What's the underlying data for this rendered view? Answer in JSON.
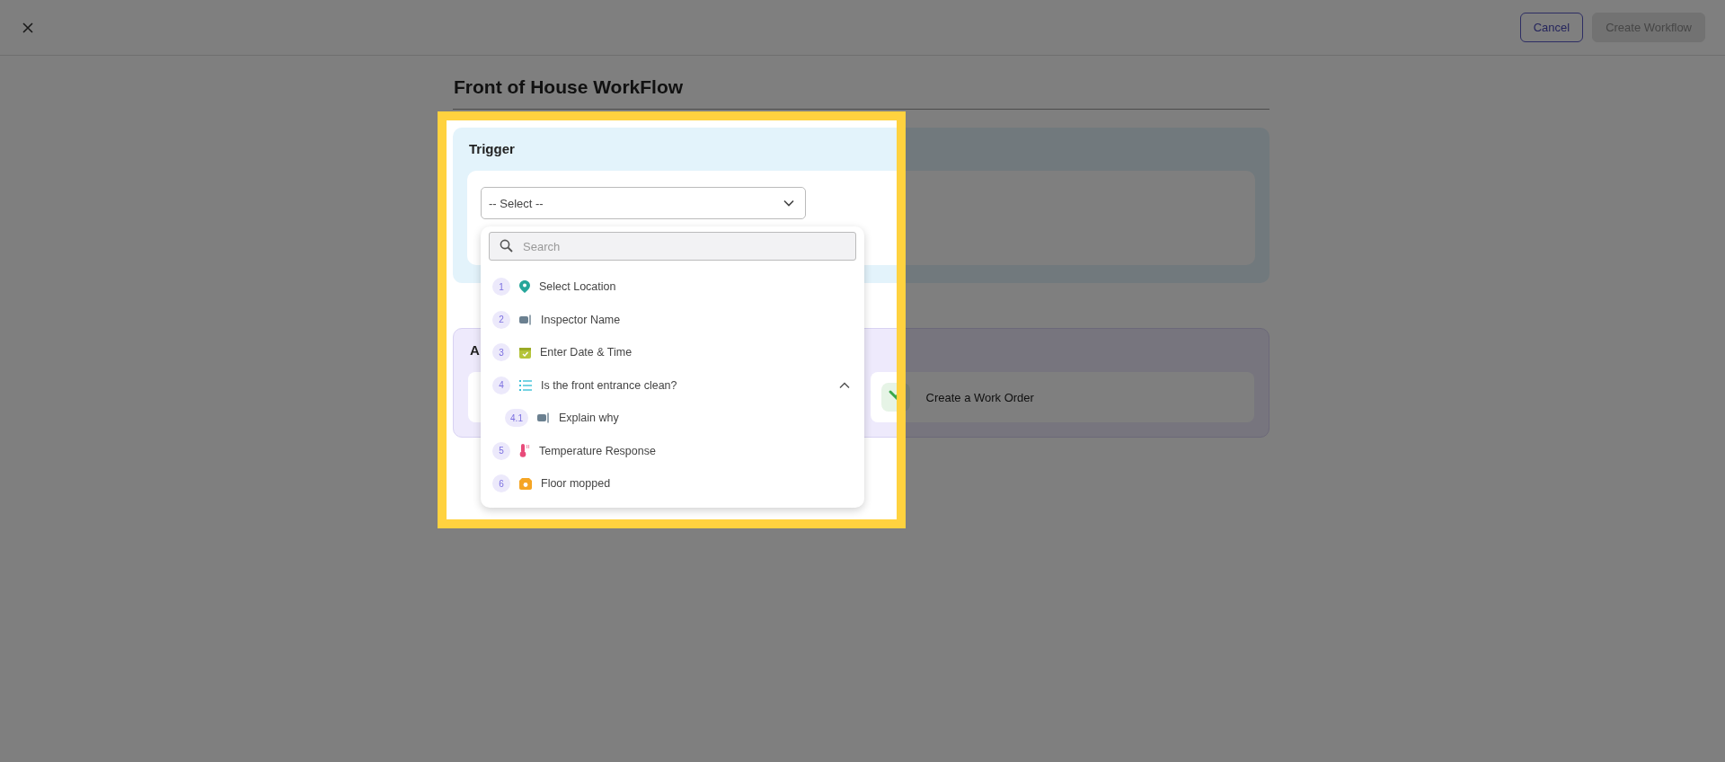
{
  "top_bar": {
    "buttons": [
      {
        "kind": "outline",
        "label": "Cancel",
        "disabled": false
      },
      {
        "kind": "primary",
        "label": "Create Workflow",
        "disabled": true
      }
    ]
  },
  "title": "Front of House WorkFlow",
  "trigger": {
    "label": "Trigger",
    "select": {
      "value": "-- Select --",
      "expanded": true
    },
    "dropdown": {
      "search": {
        "placeholder": "Search"
      },
      "items": [
        {
          "number": "1",
          "kind": "location",
          "label": "Select Location"
        },
        {
          "number": "2",
          "kind": "text",
          "label": "Inspector Name"
        },
        {
          "number": "3",
          "kind": "datetime",
          "label": "Enter Date & Time"
        },
        {
          "number": "4",
          "kind": "checklist",
          "label": "Is the front entrance clean?",
          "expanded": true,
          "children": [
            {
              "number": "4.1",
              "kind": "text",
              "label": "Explain why"
            }
          ]
        },
        {
          "number": "5",
          "kind": "temperature",
          "label": "Temperature Response"
        },
        {
          "number": "6",
          "kind": "photo",
          "label": "Floor mopped"
        }
      ]
    }
  },
  "actions": {
    "label": "A",
    "cards": [
      {
        "kind": "covered"
      },
      {
        "kind": "work_order",
        "label": "Create a Work Order"
      }
    ]
  }
}
